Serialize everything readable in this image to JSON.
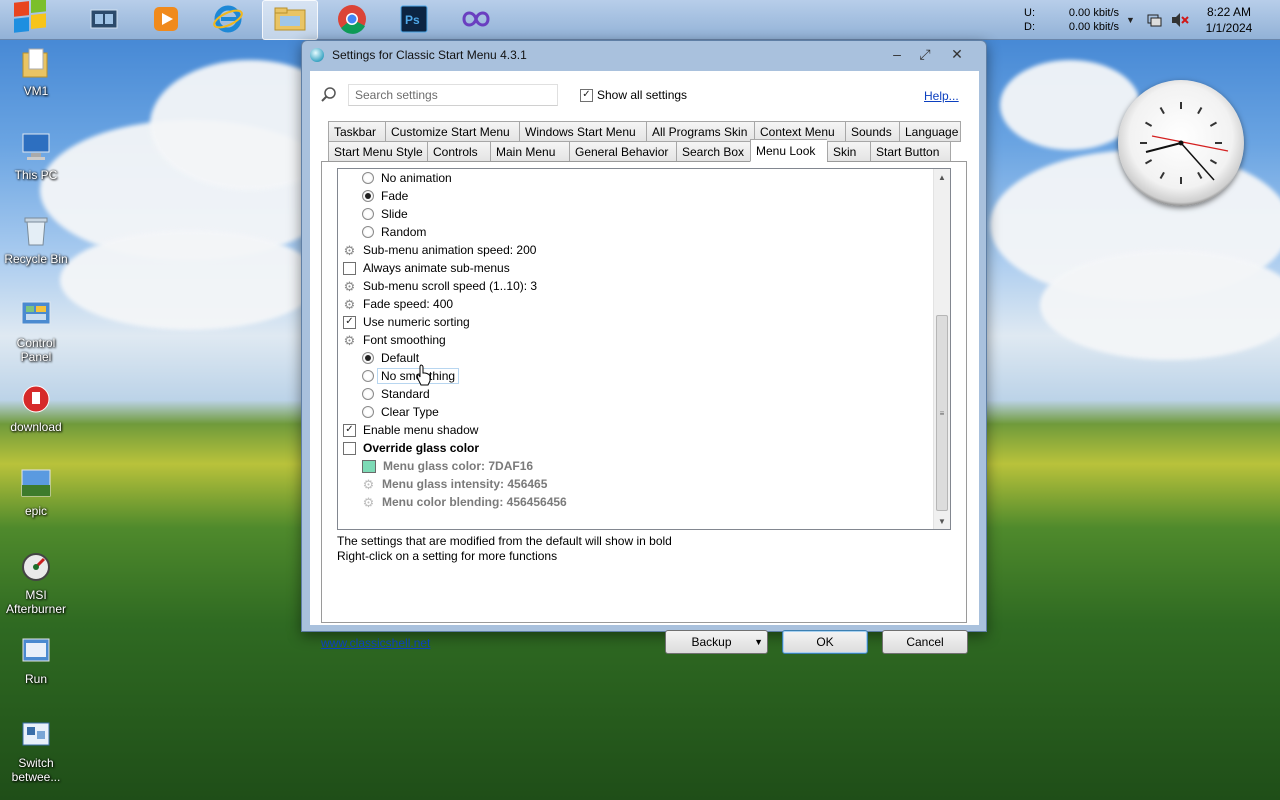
{
  "taskbar": {
    "network": {
      "up_label": "U:",
      "up_value": "0.00 kbit/s",
      "down_label": "D:",
      "down_value": "0.00 kbit/s"
    },
    "clock": {
      "time": "8:22 AM",
      "date": "1/1/2024"
    }
  },
  "desktop_icons": [
    {
      "label": "VM1"
    },
    {
      "label": "This PC"
    },
    {
      "label": "Recycle Bin"
    },
    {
      "label": "Control Panel"
    },
    {
      "label": "download"
    },
    {
      "label": "epic"
    },
    {
      "label": "MSI Afterburner"
    },
    {
      "label": "Run"
    },
    {
      "label": "Switch betwee..."
    }
  ],
  "window": {
    "title": "Settings for Classic Start Menu 4.3.1",
    "search": {
      "placeholder": "Search settings",
      "value": ""
    },
    "show_all_label": "Show all settings",
    "help_label": "Help...",
    "tabs_row1": [
      "Taskbar",
      "Customize Start Menu",
      "Windows Start Menu",
      "All Programs Skin",
      "Context Menu",
      "Sounds",
      "Language"
    ],
    "tabs_row2": [
      "Start Menu Style",
      "Controls",
      "Main Menu",
      "General Behavior",
      "Search Box",
      "Menu Look",
      "Skin",
      "Start Button"
    ],
    "selected_tab": "Menu Look",
    "settings": [
      {
        "label": "No animation"
      },
      {
        "label": "Fade"
      },
      {
        "label": "Slide"
      },
      {
        "label": "Random"
      },
      {
        "label": "Sub-menu animation speed: 200"
      },
      {
        "label": "Always animate sub-menus"
      },
      {
        "label": "Sub-menu scroll speed (1..10): 3"
      },
      {
        "label": "Fade speed: 400"
      },
      {
        "label": "Use numeric sorting"
      },
      {
        "label": "Font smoothing"
      },
      {
        "label": "Default"
      },
      {
        "label": "No smoothing"
      },
      {
        "label": "Standard"
      },
      {
        "label": "Clear Type"
      },
      {
        "label": "Enable menu shadow"
      },
      {
        "label": "Override glass color"
      },
      {
        "label": "Menu glass color: 7DAF16"
      },
      {
        "label": "Menu glass intensity: 456465"
      },
      {
        "label": "Menu color blending: 456456456"
      }
    ],
    "glass_color": "#7DAF16",
    "note_line1": "The settings that are modified from the default will show in bold",
    "note_line2": "Right-click on a setting for more functions",
    "website": "www.classicshell.net",
    "buttons": {
      "backup": "Backup",
      "ok": "OK",
      "cancel": "Cancel"
    }
  }
}
